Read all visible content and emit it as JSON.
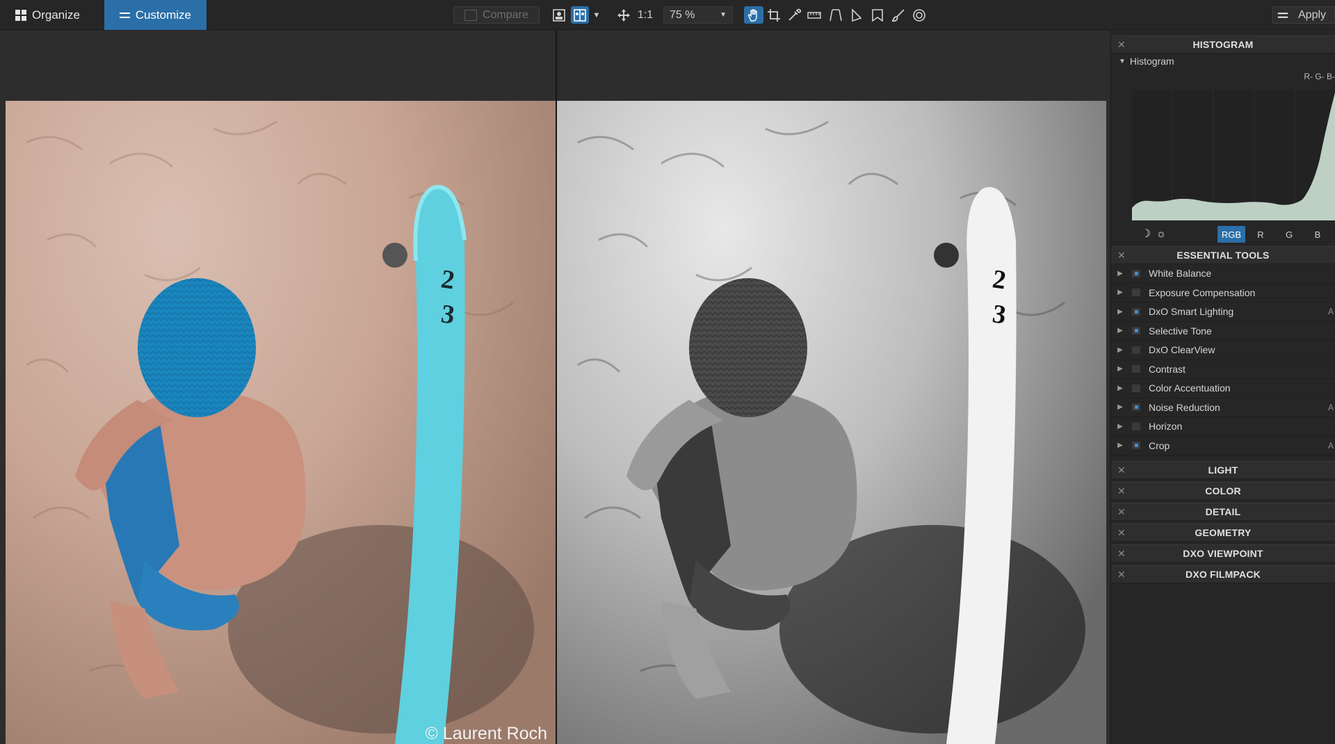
{
  "topbar": {
    "tabs": [
      {
        "label": "Organize",
        "icon": "grid-icon",
        "active": false
      },
      {
        "label": "Customize",
        "icon": "sliders-icon",
        "active": true
      }
    ],
    "compare_label": "Compare",
    "fit_label": "1:1",
    "zoom_value": "75 %",
    "apply_label": "Apply",
    "tools": [
      "single-view-icon",
      "split-view-icon",
      "move-icon",
      "hand-icon",
      "crop-icon",
      "pipette-icon",
      "ruler-icon",
      "perspective-icon",
      "volume-deformation-icon",
      "red-eye-icon",
      "brush-icon",
      "dust-icon"
    ],
    "accent_color": "#2b6fa8"
  },
  "viewer": {
    "credit": "© Laurent Roch"
  },
  "histogram": {
    "section_title": "HISTOGRAM",
    "subtitle": "Histogram",
    "legend": "R- G- B-",
    "buttons": [
      "RGB",
      "R",
      "G",
      "B"
    ],
    "active_button": "RGB"
  },
  "essential_tools": {
    "section_title": "ESSENTIAL TOOLS",
    "items": [
      {
        "label": "White Balance",
        "enabled": true
      },
      {
        "label": "Exposure Compensation",
        "enabled": false
      },
      {
        "label": "DxO Smart Lighting",
        "enabled": true
      },
      {
        "label": "Selective Tone",
        "enabled": true
      },
      {
        "label": "DxO ClearView",
        "enabled": false
      },
      {
        "label": "Contrast",
        "enabled": false
      },
      {
        "label": "Color Accentuation",
        "enabled": false
      },
      {
        "label": "Noise Reduction",
        "enabled": true
      },
      {
        "label": "Horizon",
        "enabled": false
      },
      {
        "label": "Crop",
        "enabled": true
      }
    ]
  },
  "collapsed_sections": [
    "LIGHT",
    "COLOR",
    "DETAIL",
    "GEOMETRY",
    "DXO VIEWPOINT",
    "DXO FILMPACK"
  ]
}
